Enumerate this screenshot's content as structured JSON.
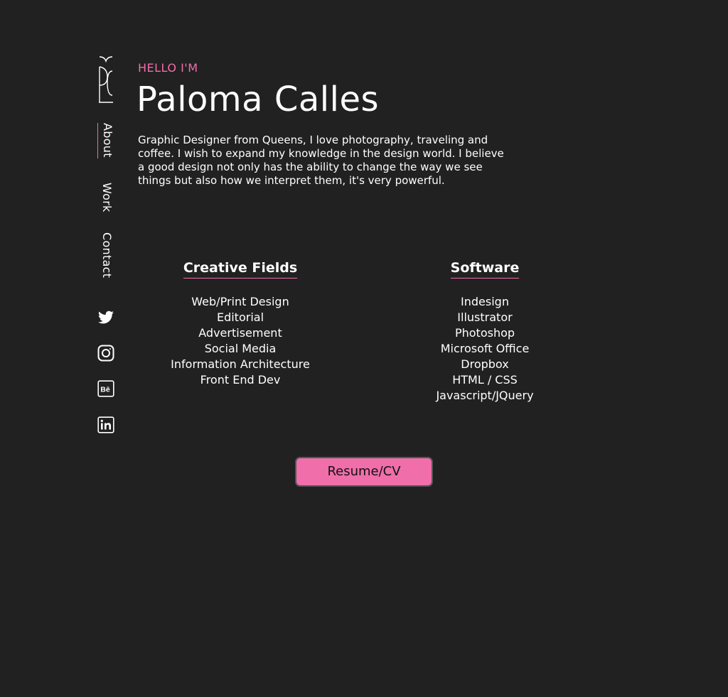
{
  "sidebar": {
    "logo_text": "PC",
    "nav": [
      {
        "label": "About",
        "active": true
      },
      {
        "label": "Work",
        "active": false
      },
      {
        "label": "Contact",
        "active": false
      }
    ],
    "social_icons": [
      "twitter-icon",
      "instagram-icon",
      "behance-icon",
      "linkedin-icon"
    ]
  },
  "intro": {
    "greeting": "HELLO I'M",
    "name": "Paloma Calles",
    "bio": "Graphic Designer from Queens, I love photography, traveling and coffee. I wish to expand my knowledge in the design world. I believe a good design not only has the ability to change the way we see things but also how we interpret them, it's very powerful."
  },
  "creative_fields": {
    "title": "Creative Fields",
    "items": [
      "Web/Print Design",
      "Editorial",
      "Advertisement",
      "Social Media",
      "Information Architecture",
      "Front End Dev"
    ]
  },
  "software": {
    "title": "Software",
    "items": [
      "Indesign",
      "Illustrator",
      "Photoshop",
      "Microsoft Office",
      "Dropbox",
      "HTML / CSS",
      "Javascript/JQuery"
    ]
  },
  "resume": {
    "label": "Resume/CV"
  },
  "colors": {
    "background": "#212121",
    "accent": "#f06ea9",
    "text": "#ffffff"
  }
}
